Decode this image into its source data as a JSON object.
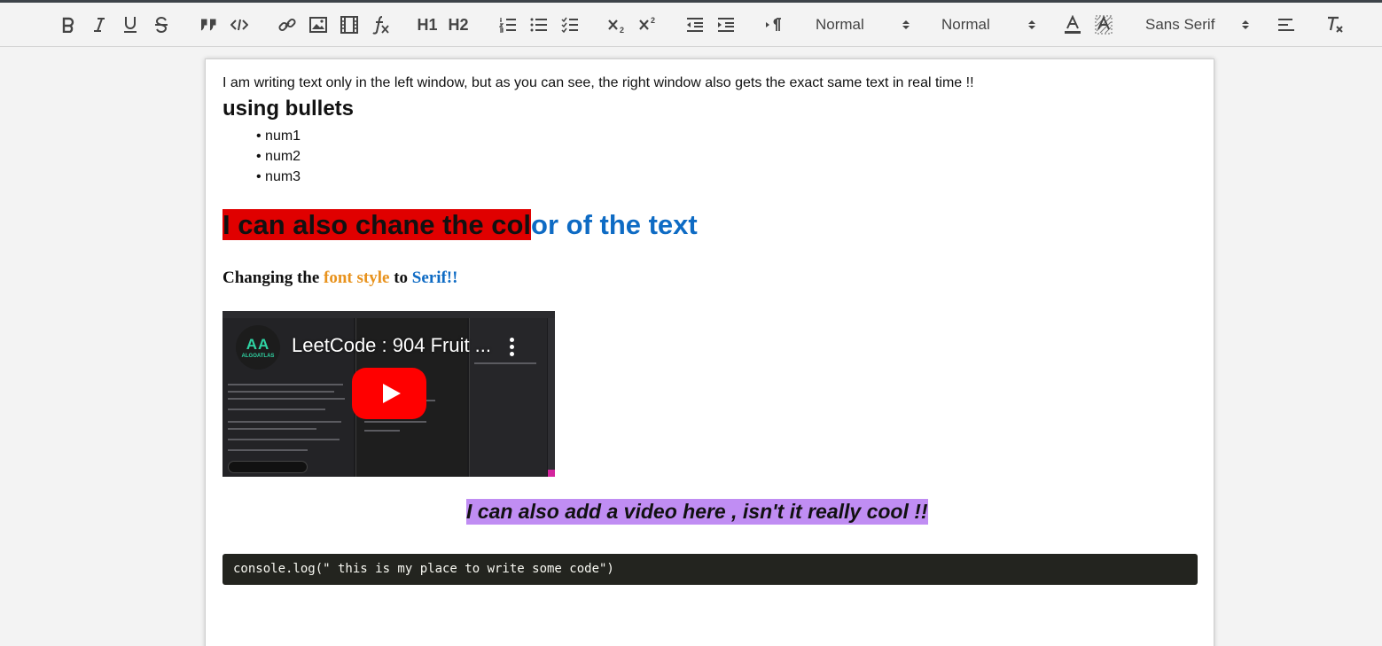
{
  "toolbar": {
    "header_picker": "Normal",
    "size_picker": "Normal",
    "font_picker": "Sans Serif",
    "h1_label": "H1",
    "h2_label": "H2",
    "colors": {
      "icon": "#444444",
      "toolbar_bg": "#f3f3f3",
      "top_bar": "#3d4349"
    }
  },
  "editor": {
    "intro_text": "I am writing text only in the left window, but as you can see, the right window also gets the exact same text in real time !!",
    "subheading": "using bullets",
    "bullets": [
      "num1",
      "num2",
      "num3"
    ],
    "colored_heading": {
      "highlighted_part": "I can also chane the col",
      "rest_part": "or of the text",
      "highlight_color": "#e00000",
      "text_color": "#0e6bc4"
    },
    "font_line": {
      "part1": "Changing the ",
      "part2": "font style",
      "part3": " to ",
      "part4": "Serif!!",
      "part2_color": "#e8921c",
      "part4_color": "#0e6bc4"
    },
    "video": {
      "title": "LeetCode : 904 Fruit ...",
      "channel_logo_text": "AA",
      "channel_logo_sub": "ALGOATLAS"
    },
    "video_caption": "I can also add a video here , isn't it really cool !!",
    "caption_bg": "#c08df3",
    "code_block": "console.log(\" this is my place to write some code\")"
  }
}
